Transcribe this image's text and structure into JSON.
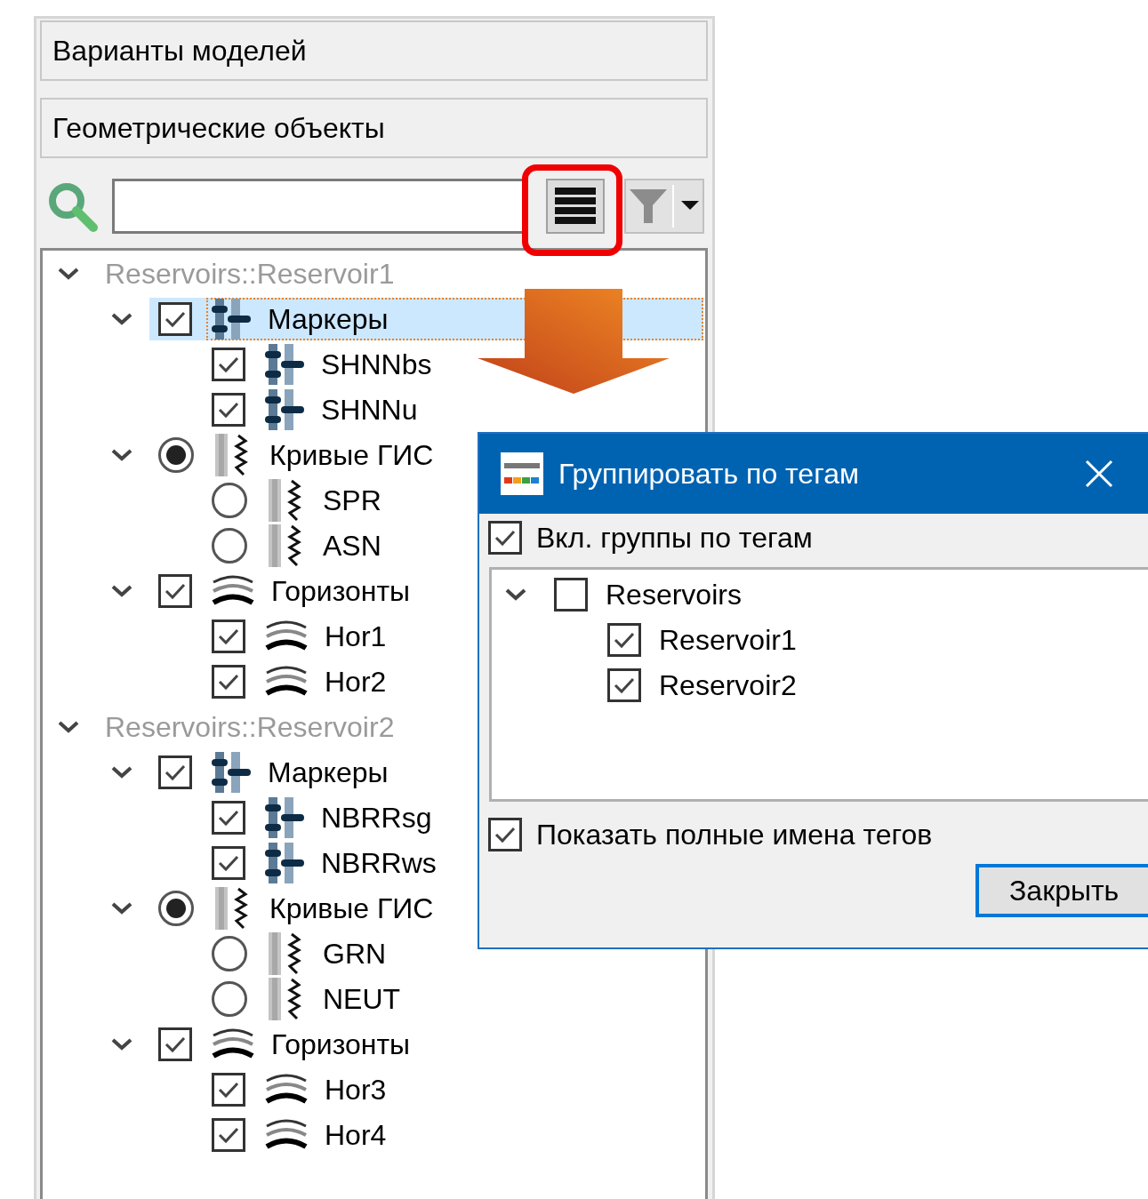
{
  "panels": [
    {
      "label": "Варианты моделей"
    },
    {
      "label": "Геометрические объекты"
    }
  ],
  "tree": [
    {
      "label": "Reservoirs::Reservoir1",
      "expanded": true,
      "children": [
        {
          "label": "Маркеры",
          "kind": "marker",
          "checked": true,
          "expanded": true,
          "selected": true,
          "children": [
            {
              "label": "SHNNbs",
              "kind": "marker",
              "checked": true,
              "selected": false
            },
            {
              "label": "SHNNu",
              "kind": "marker",
              "checked": true,
              "selected": false
            }
          ]
        },
        {
          "label": "Кривые ГИС",
          "kind": "curve",
          "checked": true,
          "expanded": true,
          "selected": false,
          "children": [
            {
              "label": "SPR",
              "kind": "curve",
              "checked": false,
              "selected": false
            },
            {
              "label": "ASN",
              "kind": "curve",
              "checked": false,
              "selected": false
            }
          ]
        },
        {
          "label": "Горизонты",
          "kind": "horizon",
          "checked": true,
          "expanded": true,
          "selected": false,
          "children": [
            {
              "label": "Hor1",
              "kind": "horizon",
              "checked": true,
              "selected": false
            },
            {
              "label": "Hor2",
              "kind": "horizon",
              "checked": true,
              "selected": false
            }
          ]
        }
      ]
    },
    {
      "label": "Reservoirs::Reservoir2",
      "expanded": true,
      "children": [
        {
          "label": "Маркеры",
          "kind": "marker",
          "checked": true,
          "expanded": true,
          "selected": false,
          "children": [
            {
              "label": "NBRRsg",
              "kind": "marker",
              "checked": true,
              "selected": false
            },
            {
              "label": "NBRRws",
              "kind": "marker",
              "checked": true,
              "selected": false
            }
          ]
        },
        {
          "label": "Кривые ГИС",
          "kind": "curve",
          "checked": true,
          "expanded": true,
          "selected": false,
          "children": [
            {
              "label": "GRN",
              "kind": "curve",
              "checked": false,
              "selected": false
            },
            {
              "label": "NEUT",
              "kind": "curve",
              "checked": false,
              "selected": false
            }
          ]
        },
        {
          "label": "Горизонты",
          "kind": "horizon",
          "checked": true,
          "expanded": true,
          "selected": false,
          "children": [
            {
              "label": "Hor3",
              "kind": "horizon",
              "checked": true,
              "selected": false
            },
            {
              "label": "Hor4",
              "kind": "horizon",
              "checked": true,
              "selected": false
            }
          ]
        }
      ]
    }
  ],
  "dialog": {
    "title": "Группировать по тегам",
    "enable_groups": {
      "label": "Вкл. группы по тегам",
      "checked": true
    },
    "tags": [
      {
        "label": "Reservoirs",
        "checked": false,
        "expanded": true,
        "children": [
          {
            "label": "Reservoir1",
            "checked": true
          },
          {
            "label": "Reservoir2",
            "checked": true
          }
        ]
      }
    ],
    "show_full_names": {
      "label": "Показать полные имена тегов",
      "checked": true
    },
    "buttons": [
      "Закрыть"
    ]
  }
}
